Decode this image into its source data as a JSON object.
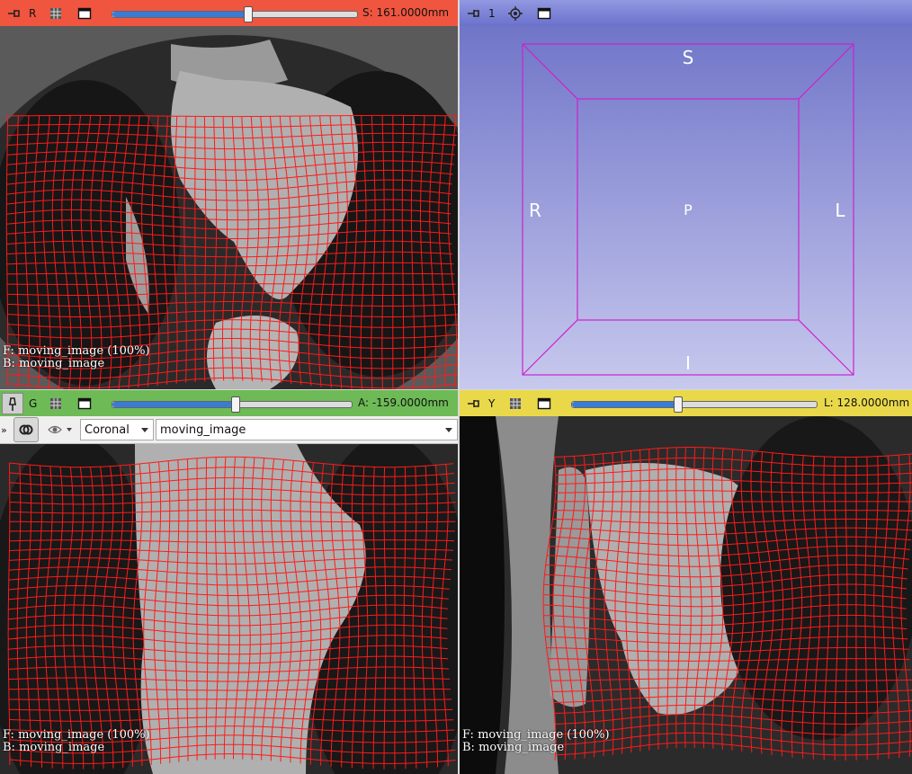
{
  "red": {
    "label": "R",
    "offset": "S: 161.0000mm",
    "slider_fraction": 0.55,
    "bar_color": "#f0553f",
    "overlay_fg": "F: moving_image (100%)",
    "overlay_bg": "B: moving_image"
  },
  "three_d": {
    "label": "1",
    "bar_color": "#7f84d6",
    "orient": {
      "top": "S",
      "bottom": "I",
      "left": "R",
      "right": "L",
      "center": "P"
    },
    "box_color": "#cc22cc"
  },
  "green": {
    "label": "G",
    "offset": "A: -159.0000mm",
    "slider_fraction": 0.51,
    "bar_color": "#6dba56",
    "orientation_option": "Coronal",
    "volume_option": "moving_image",
    "overlay_fg": "F: moving_image (100%)",
    "overlay_bg": "B: moving_image"
  },
  "yellow": {
    "label": "Y",
    "offset": "L: 128.0000mm",
    "slider_fraction": 0.43,
    "bar_color": "#e9d94a",
    "overlay_fg": "F: moving_image (100%)",
    "overlay_bg": "B: moving_image"
  },
  "icons": {
    "pin": "pin-icon",
    "link": "link-icon",
    "maximize": "maximize-icon",
    "eye": "eye-icon",
    "more": "double-chevron-icon"
  },
  "grid_color": "#ff1a1a"
}
